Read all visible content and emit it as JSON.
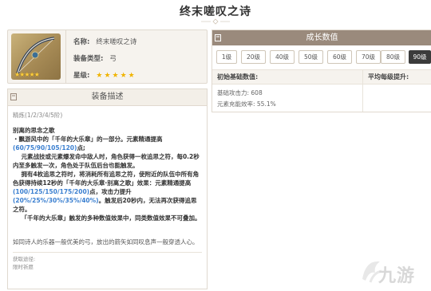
{
  "page": {
    "title": "终末嗟叹之诗"
  },
  "info": {
    "name_key": "名称:",
    "name_val": "终末嗟叹之诗",
    "type_key": "装备类型:",
    "type_val": "弓",
    "rarity_key": "星级:",
    "rarity_stars": "★★★★★"
  },
  "description": {
    "header": "装备描述",
    "refinement": "精炼(1/2/3/4/5阶)",
    "passive_title": "别离的思念之歌",
    "p1_a": "・飘游风中的「千年的大乐章」的一部分。元素精通提高",
    "p1_hl": "(60/75/90/105/120)",
    "p1_b": "点;",
    "p2": "元素战技或元素爆发命中敌人时，角色获得一枚追思之符，每0.2秒内至多触发一次，角色处于队伍后台也能触发。",
    "p3_a": "拥有4枚追思之符时，将消耗所有追思之符，使附近的队伍中所有角色获得持续12秒的「千年的大乐章·别离之歌」效果：元素精通提高",
    "p3_hl1": "(100/125/150/175/200)",
    "p3_b": "点，攻击力提升",
    "p3_hl2": "(20%/25%/30%/35%/40%)",
    "p3_c": "。触发后20秒内，无法再次获得追思之符。",
    "p4": "「千年的大乐章」触发的多种数值效果中，同类数值效果不可叠加。",
    "lore": "如同诗人的乐器一般优美的弓，放出的箭矢如同叹息声一般穿透人心。",
    "source_label": "获取途径:",
    "source_val": "限时祈愿"
  },
  "growth": {
    "header": "成长数值",
    "levels": [
      "1级",
      "20级",
      "40级",
      "50级",
      "60级",
      "70级",
      "80级",
      "90级"
    ],
    "active_level": "90级",
    "col_base": "初始基础数值:",
    "col_gain": "平均每级提升:",
    "stats": [
      "基础攻击力: 608",
      "元素充能效率: 55.1%"
    ]
  },
  "watermark": {
    "text": "九游"
  },
  "colors": {
    "accent_blue": "#3a7fd0",
    "header_brown": "#9a8a7c",
    "star_gold": "#f0b400"
  }
}
